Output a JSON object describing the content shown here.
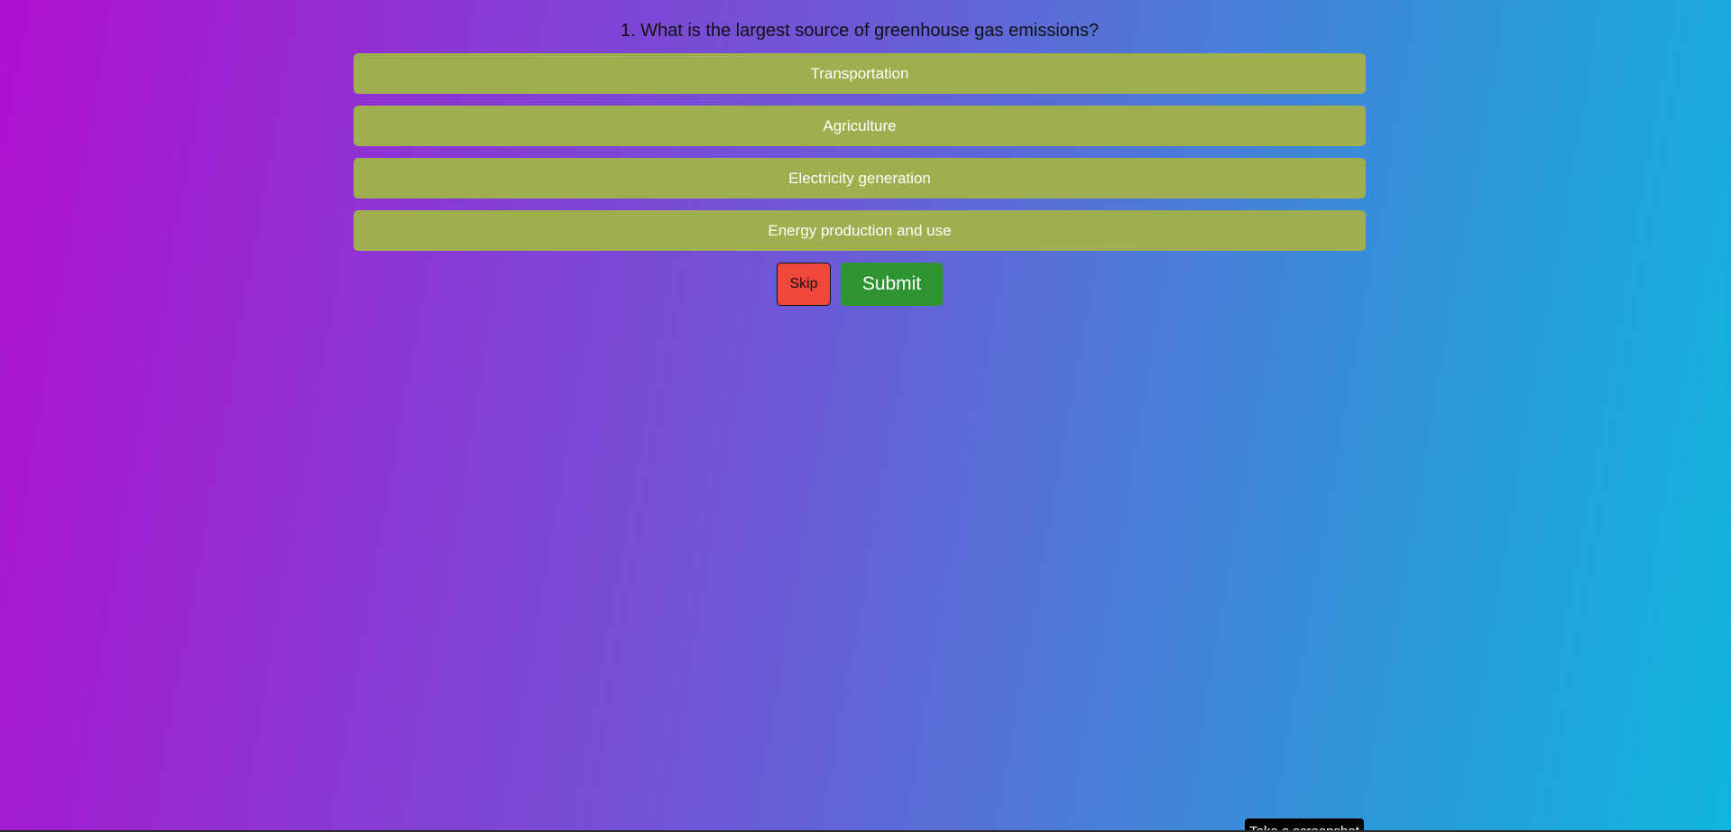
{
  "quiz": {
    "question": "1. What is the largest source of greenhouse gas emissions?",
    "options": [
      "Transportation",
      "Agriculture",
      "Electricity generation",
      "Energy production and use"
    ],
    "skip_label": "Skip",
    "submit_label": "Submit"
  },
  "screenshot": {
    "label": "Take a screenshot"
  },
  "colors": {
    "option_bg": "#9fae4f",
    "skip_bg": "#f0473a",
    "submit_bg": "#2e9432"
  }
}
